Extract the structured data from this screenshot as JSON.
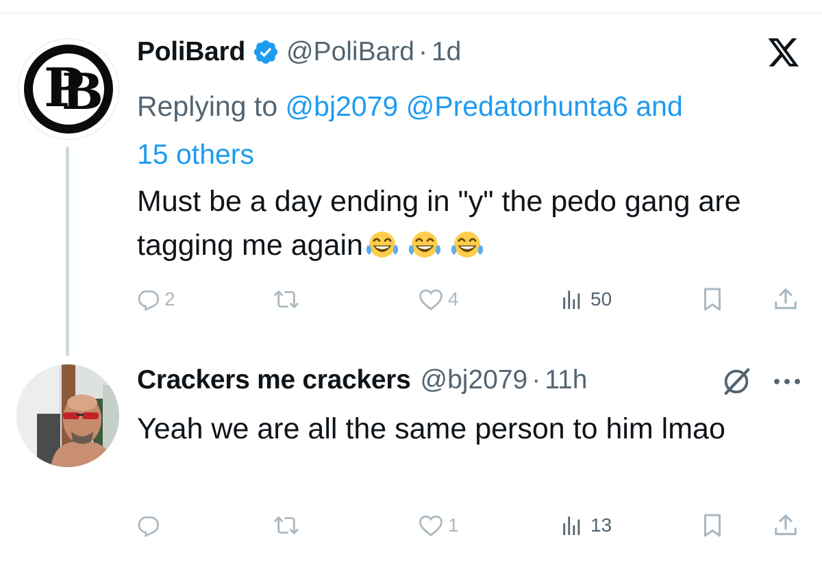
{
  "tweet1": {
    "display_name": "PoliBard",
    "handle": "@PoliBard",
    "separator": "·",
    "time": "1d",
    "avatar_letters": "PB",
    "replying_to_label": "Replying to",
    "mentions": [
      "@bj2079",
      "@Predatorhunta6",
      "and"
    ],
    "others": "15 others",
    "text": "Must be a day ending in \"y\" the pedo gang are tagging me again",
    "emoji_names": [
      "joy-emoji",
      "joy-emoji",
      "joy-emoji"
    ],
    "actions": {
      "replies": "2",
      "reposts": "",
      "likes": "4",
      "views": "50"
    }
  },
  "tweet2": {
    "display_name": "Crackers me crackers",
    "handle": "@bj2079",
    "separator": "·",
    "time": "11h",
    "text": "Yeah we are all the same person to him lmao",
    "actions": {
      "replies": "",
      "reposts": "",
      "likes": "1",
      "views": "13"
    }
  },
  "icons": {
    "platform": "x-logo-icon",
    "verified": "verified-badge-icon",
    "grok": "grok-icon",
    "more": "more-icon",
    "reply": "reply-icon",
    "repost": "repost-icon",
    "like": "like-icon",
    "views": "views-icon",
    "bookmark": "bookmark-icon",
    "share": "share-icon"
  },
  "colors": {
    "link": "#1d9bf0",
    "secondary_text": "#536471",
    "primary_text": "#0f1419",
    "faded_icon": "#aab8c2",
    "verified": "#1d9bf0"
  }
}
